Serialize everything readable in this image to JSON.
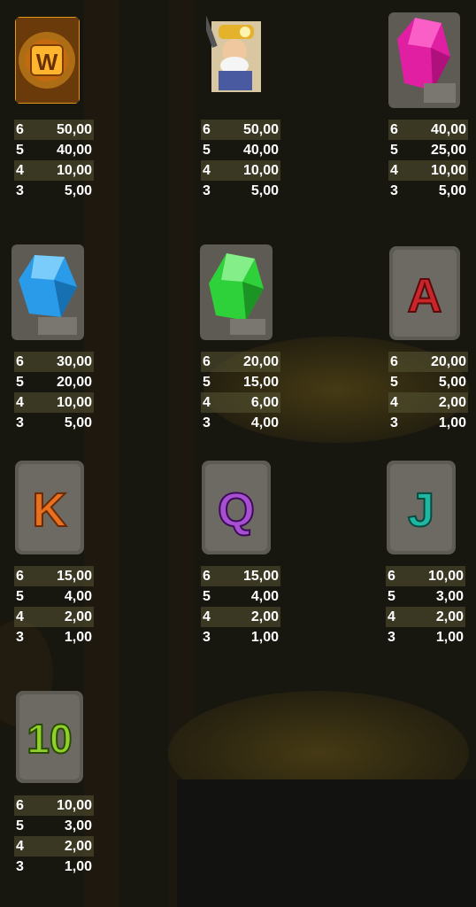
{
  "symbols": [
    {
      "id": "wild",
      "label": "W",
      "pays": [
        {
          "count": "6",
          "value": "50,00"
        },
        {
          "count": "5",
          "value": "40,00"
        },
        {
          "count": "4",
          "value": "10,00"
        },
        {
          "count": "3",
          "value": "5,00"
        }
      ]
    },
    {
      "id": "miner",
      "label": "",
      "pays": [
        {
          "count": "6",
          "value": "50,00"
        },
        {
          "count": "5",
          "value": "40,00"
        },
        {
          "count": "4",
          "value": "10,00"
        },
        {
          "count": "3",
          "value": "5,00"
        }
      ]
    },
    {
      "id": "pink-gem",
      "label": "",
      "pays": [
        {
          "count": "6",
          "value": "40,00"
        },
        {
          "count": "5",
          "value": "25,00"
        },
        {
          "count": "4",
          "value": "10,00"
        },
        {
          "count": "3",
          "value": "5,00"
        }
      ]
    },
    {
      "id": "blue-gem",
      "label": "",
      "pays": [
        {
          "count": "6",
          "value": "30,00"
        },
        {
          "count": "5",
          "value": "20,00"
        },
        {
          "count": "4",
          "value": "10,00"
        },
        {
          "count": "3",
          "value": "5,00"
        }
      ]
    },
    {
      "id": "green-gem",
      "label": "",
      "pays": [
        {
          "count": "6",
          "value": "20,00"
        },
        {
          "count": "5",
          "value": "15,00"
        },
        {
          "count": "4",
          "value": "6,00"
        },
        {
          "count": "3",
          "value": "4,00"
        }
      ]
    },
    {
      "id": "letter-a",
      "label": "A",
      "pays": [
        {
          "count": "6",
          "value": "20,00"
        },
        {
          "count": "5",
          "value": "5,00"
        },
        {
          "count": "4",
          "value": "2,00"
        },
        {
          "count": "3",
          "value": "1,00"
        }
      ]
    },
    {
      "id": "letter-k",
      "label": "K",
      "pays": [
        {
          "count": "6",
          "value": "15,00"
        },
        {
          "count": "5",
          "value": "4,00"
        },
        {
          "count": "4",
          "value": "2,00"
        },
        {
          "count": "3",
          "value": "1,00"
        }
      ]
    },
    {
      "id": "letter-q",
      "label": "Q",
      "pays": [
        {
          "count": "6",
          "value": "15,00"
        },
        {
          "count": "5",
          "value": "4,00"
        },
        {
          "count": "4",
          "value": "2,00"
        },
        {
          "count": "3",
          "value": "1,00"
        }
      ]
    },
    {
      "id": "letter-j",
      "label": "J",
      "pays": [
        {
          "count": "6",
          "value": "10,00"
        },
        {
          "count": "5",
          "value": "3,00"
        },
        {
          "count": "4",
          "value": "2,00"
        },
        {
          "count": "3",
          "value": "1,00"
        }
      ]
    },
    {
      "id": "number-10",
      "label": "10",
      "pays": [
        {
          "count": "6",
          "value": "10,00"
        },
        {
          "count": "5",
          "value": "3,00"
        },
        {
          "count": "4",
          "value": "2,00"
        },
        {
          "count": "3",
          "value": "1,00"
        }
      ]
    }
  ],
  "colors": {
    "wild": "#e39a1c",
    "pink": "#e01fa3",
    "blue": "#2a9be8",
    "green": "#2fd13a",
    "a": "#c8262b",
    "k": "#e8701f",
    "q": "#a64fd0",
    "j": "#1fb7a2",
    "ten": "#8fd12a",
    "stone": "#5e5b55"
  }
}
